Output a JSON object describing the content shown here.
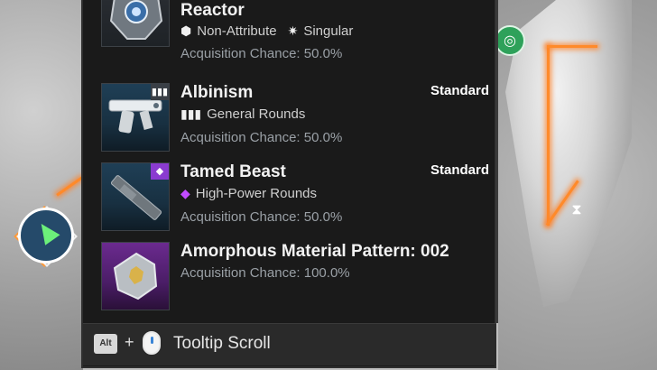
{
  "items": [
    {
      "title": "Materialized Singularity\nReactor",
      "tag": "",
      "attributes": [
        {
          "icon": "cube-icon",
          "label": "Non-Attribute"
        },
        {
          "icon": "gear-icon",
          "label": "Singular"
        }
      ],
      "chance": "Acquisition Chance: 50.0%"
    },
    {
      "title": "Albinism",
      "tag": "Standard",
      "attributes": [
        {
          "icon": "ammo-icon",
          "label": "General Rounds"
        }
      ],
      "chance": "Acquisition Chance: 50.0%"
    },
    {
      "title": "Tamed Beast",
      "tag": "Standard",
      "attributes": [
        {
          "icon": "high-power-ammo-icon",
          "label": "High-Power Rounds"
        }
      ],
      "chance": "Acquisition Chance: 50.0%"
    },
    {
      "title": "Amorphous Material Pattern: 002",
      "tag": "",
      "attributes": [],
      "chance": "Acquisition Chance: 100.0%"
    }
  ],
  "footer": {
    "key": "Alt",
    "plus": "+",
    "label": "Tooltip Scroll"
  },
  "colors": {
    "panel_bg": "#1a1a1a",
    "footer_bg": "#2a2a2a",
    "map_route": "#ff8a2a",
    "high_power": "#c14bff"
  }
}
